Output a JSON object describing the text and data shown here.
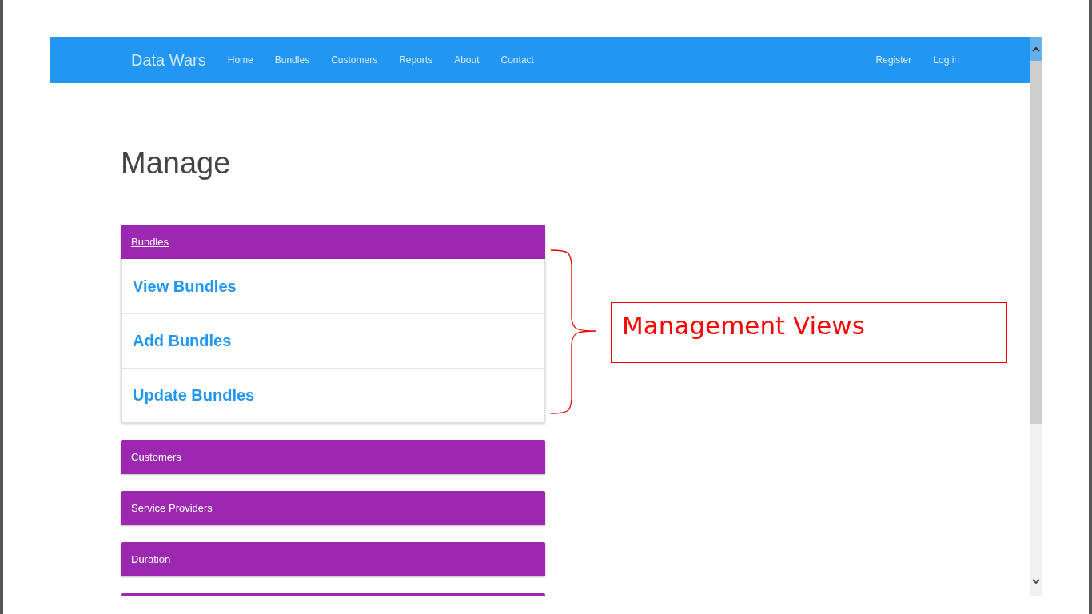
{
  "navbar": {
    "brand": "Data Wars",
    "links": [
      {
        "label": "Home"
      },
      {
        "label": "Bundles"
      },
      {
        "label": "Customers"
      },
      {
        "label": "Reports"
      },
      {
        "label": "About"
      },
      {
        "label": "Contact"
      }
    ],
    "right_links": [
      {
        "label": "Register"
      },
      {
        "label": "Log in"
      }
    ]
  },
  "page": {
    "title": "Manage"
  },
  "panels": [
    {
      "kind": "full",
      "title": "Bundles",
      "hovered": true,
      "items": [
        {
          "label": "View Bundles"
        },
        {
          "label": "Add Bundles"
        },
        {
          "label": "Update Bundles"
        }
      ]
    },
    {
      "kind": "full",
      "title": "Customers",
      "hovered": false
    },
    {
      "kind": "full",
      "title": "Service Providers",
      "hovered": false
    },
    {
      "kind": "full",
      "title": "Duration",
      "hovered": false
    },
    {
      "kind": "cut_off"
    }
  ],
  "annotation": {
    "text": "Management Views"
  }
}
